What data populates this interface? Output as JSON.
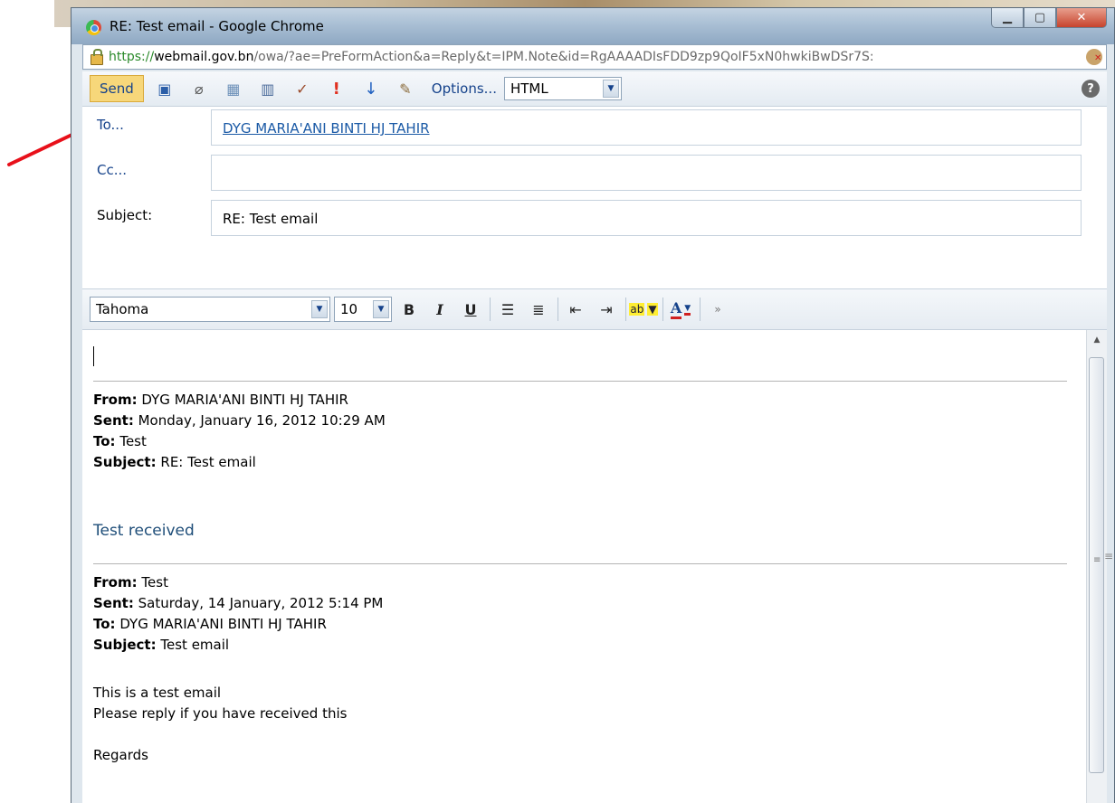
{
  "window": {
    "title": "RE: Test email - Google Chrome",
    "url_scheme": "https://",
    "url_host": "webmail.gov.bn",
    "url_path": "/owa/?ae=PreFormAction&a=Reply&t=IPM.Note&id=RgAAAADIsFDD9zp9QoIF5xN0hwkiBwDSr7S:"
  },
  "toolbar": {
    "send_label": "Send",
    "options_label": "Options...",
    "format_value": "HTML",
    "help_label": "?"
  },
  "fields": {
    "to_label": "To...",
    "to_value": "DYG MARIA'ANI BINTI HJ TAHIR",
    "cc_label": "Cc...",
    "cc_value": "",
    "subject_label": "Subject:",
    "subject_value": "RE: Test email"
  },
  "formatting": {
    "font_value": "Tahoma",
    "size_value": "10",
    "bold": "B",
    "italic": "I",
    "underline": "U"
  },
  "message": {
    "header1": {
      "from_label": "From:",
      "from_value": "DYG MARIA'ANI BINTI HJ TAHIR",
      "sent_label": "Sent:",
      "sent_value": "Monday, January 16, 2012 10:29 AM",
      "to_label": "To:",
      "to_value": "Test",
      "subject_label": "Subject:",
      "subject_value": "RE: Test email"
    },
    "reply_text": "Test received",
    "header2": {
      "from_label": "From:",
      "from_value": "Test",
      "sent_label": "Sent:",
      "sent_value": "Saturday, 14 January, 2012 5:14 PM",
      "to_label": "To:",
      "to_value": "DYG MARIA'ANI BINTI HJ TAHIR",
      "subject_label": "Subject:",
      "subject_value": "Test email"
    },
    "body_line1": "This is a test email",
    "body_line2": "Please reply if you have received this",
    "closing": "Regards"
  },
  "colors": {
    "annotation_arrow": "#e8101a",
    "send_button": "#f7d77a",
    "link_blue": "#15428b"
  }
}
